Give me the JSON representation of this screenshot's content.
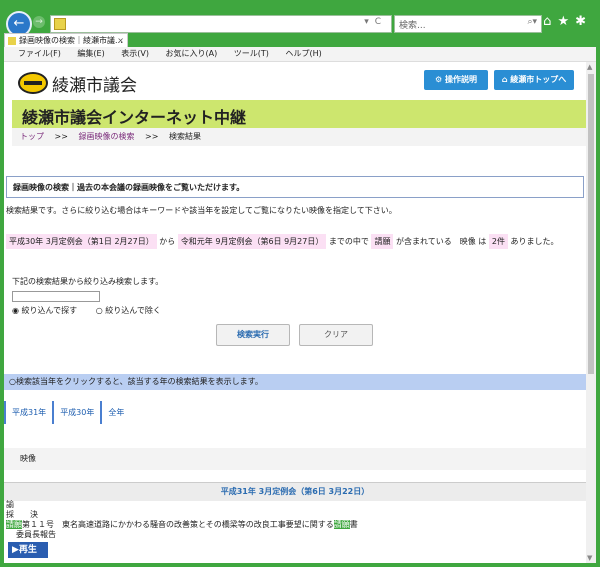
{
  "browser": {
    "search_placeholder": "検索...",
    "tab_title": "録画映像の検索｜綾瀬市議...",
    "menu": [
      "ファイル(F)",
      "編集(E)",
      "表示(V)",
      "お気に入り(A)",
      "ツール(T)",
      "ヘルプ(H)"
    ]
  },
  "site": {
    "name": "綾瀬市議会",
    "help_label": "操作説明",
    "top_label": "綾瀬市トップへ",
    "banner": "綾瀬市議会インターネット中継"
  },
  "breadcrumb": {
    "top": "トップ",
    "sep": ">>",
    "search": "録画映像の検索",
    "current": "検索結果"
  },
  "main": {
    "infobox": "録画映像の検索｜過去の本会議の録画映像をご覧いただけます。",
    "description": "検索結果です。さらに絞り込む場合はキーワードや該当年を設定してご覧になりたい映像を指定して下さい。",
    "cond": {
      "from": "平成30年 3月定例会（第1日 2月27日）",
      "from_suffix": "から",
      "to": "令和元年 9月定例会（第6日 9月27日）",
      "to_suffix": "までの中で",
      "keyword": "請願",
      "keyword_suffix": "が含まれている　映像 は",
      "count": "2件",
      "count_suffix": "ありました。"
    },
    "narrow_label": "下記の検索結果から絞り込み検索します。",
    "narrow_value": "",
    "radio_include": "絞り込んで探す",
    "radio_exclude": "絞り込んで除く",
    "exec_label": "検索実行",
    "clear_label": "クリア",
    "year_note": "○検索該当年をクリックすると、該当する年の検索結果を表示します。",
    "years": [
      "平成31年",
      "平成30年",
      "全年"
    ],
    "eizou_label": "映像",
    "session_title": "平成31年 3月定例会（第6日 3月22日）",
    "detail": {
      "line1": "諭",
      "line2": "採　　決",
      "line3_a": "請願",
      "line3_b": "第１１号　東名高速道路にかかわる騒音の改善策とその橋梁等の改良工事要望に関する",
      "line3_c": "請願",
      "line3_d": "書",
      "line4": "委員長報告"
    },
    "play_label": "▶再生"
  }
}
